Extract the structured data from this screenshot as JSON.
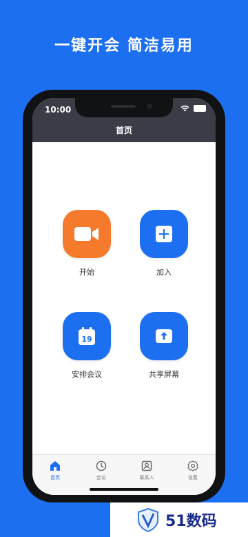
{
  "headline": "一键开会  简洁易用",
  "status_bar": {
    "time": "10:00"
  },
  "page_title": "首页",
  "actions": [
    {
      "label": "开始",
      "icon": "video-camera-icon",
      "color": "#f57a2b"
    },
    {
      "label": "加入",
      "icon": "plus-icon",
      "color": "#1b6ff0"
    },
    {
      "label": "安排会议",
      "icon": "calendar-icon",
      "calendar_day": "19",
      "color": "#1b6ff0"
    },
    {
      "label": "共享屏幕",
      "icon": "upload-screen-icon",
      "color": "#1b6ff0"
    }
  ],
  "bottom_nav": [
    {
      "label": "首页",
      "icon": "home-icon",
      "active": true
    },
    {
      "label": "会议",
      "icon": "clock-icon",
      "active": false
    },
    {
      "label": "联系人",
      "icon": "contact-icon",
      "active": false
    },
    {
      "label": "设置",
      "icon": "gear-icon",
      "active": false
    }
  ],
  "watermark": {
    "text": "51数码"
  },
  "colors": {
    "background": "#1b6ff0",
    "accent_orange": "#f57a2b",
    "topbar": "#3b3c45"
  }
}
